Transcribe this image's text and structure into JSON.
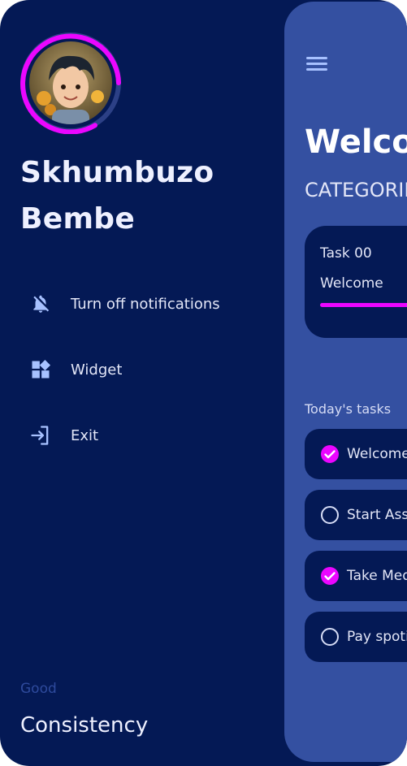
{
  "user": {
    "first_name": "Skhumbuzo",
    "last_name": "Bembe",
    "avatar_progress": 0.8
  },
  "drawer": {
    "items": [
      {
        "label": "Turn off notifications",
        "icon": "notifications-off-icon"
      },
      {
        "label": "Widget",
        "icon": "widgets-icon"
      },
      {
        "label": "Exit",
        "icon": "exit-icon"
      }
    ],
    "footer": {
      "rating": "Good",
      "title": "Consistency"
    }
  },
  "main": {
    "title": "Welcome",
    "categories_label": "CATEGORIES",
    "category_card": {
      "count": "Task 00",
      "name": "Welcome"
    },
    "today_label": "Today's tasks",
    "tasks": [
      {
        "title": "Welcome",
        "done": true
      },
      {
        "title": "Start Assignment",
        "done": false
      },
      {
        "title": "Take Medication",
        "done": true
      },
      {
        "title": "Pay spotify",
        "done": false
      }
    ]
  },
  "colors": {
    "drawer_bg": "#041955",
    "panel_bg": "#3450a1",
    "accent": "#eb06ff",
    "icon": "#a7c1ff"
  }
}
